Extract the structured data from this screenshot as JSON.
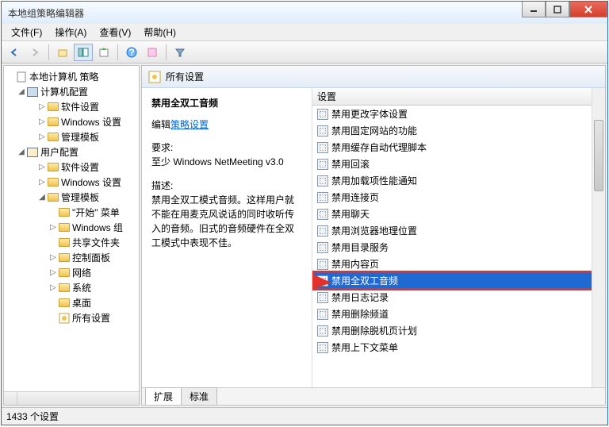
{
  "window": {
    "title": "本地组策略编辑器"
  },
  "menu": {
    "file": "文件(F)",
    "action": "操作(A)",
    "view": "查看(V)",
    "help": "帮助(H)"
  },
  "tree": {
    "root": "本地计算机 策略",
    "computer_config": "计算机配置",
    "cc_software": "软件设置",
    "cc_windows": "Windows 设置",
    "cc_admin": "管理模板",
    "user_config": "用户配置",
    "uc_software": "软件设置",
    "uc_windows": "Windows 设置",
    "uc_admin": "管理模板",
    "start_menu": "\"开始\" 菜单",
    "windows_comp": "Windows 组",
    "shared": "共享文件夹",
    "control_panel": "控制面板",
    "network": "网络",
    "system": "系统",
    "desktop": "桌面",
    "all_settings": "所有设置"
  },
  "header": {
    "title": "所有设置"
  },
  "detail": {
    "title": "禁用全双工音频",
    "edit_prefix": "编辑",
    "edit_link": "策略设置",
    "req_label": "要求:",
    "req_value": "至少 Windows NetMeeting v3.0",
    "desc_label": "描述:",
    "desc_value": "禁用全双工模式音频。这样用户就不能在用麦克风说话的同时收听传入的音频。旧式的音频硬件在全双工模式中表现不佳。"
  },
  "list": {
    "column": "设置",
    "items": [
      "禁用更改字体设置",
      "禁用固定网站的功能",
      "禁用缓存自动代理脚本",
      "禁用回滚",
      "禁用加载项性能通知",
      "禁用连接页",
      "禁用聊天",
      "禁用浏览器地理位置",
      "禁用目录服务",
      "禁用内容页",
      "禁用全双工音频",
      "禁用日志记录",
      "禁用删除频道",
      "禁用删除脱机页计划",
      "禁用上下文菜单"
    ],
    "selected_index": 10
  },
  "tabs": {
    "extended": "扩展",
    "standard": "标准"
  },
  "status": {
    "text": "1433 个设置"
  }
}
